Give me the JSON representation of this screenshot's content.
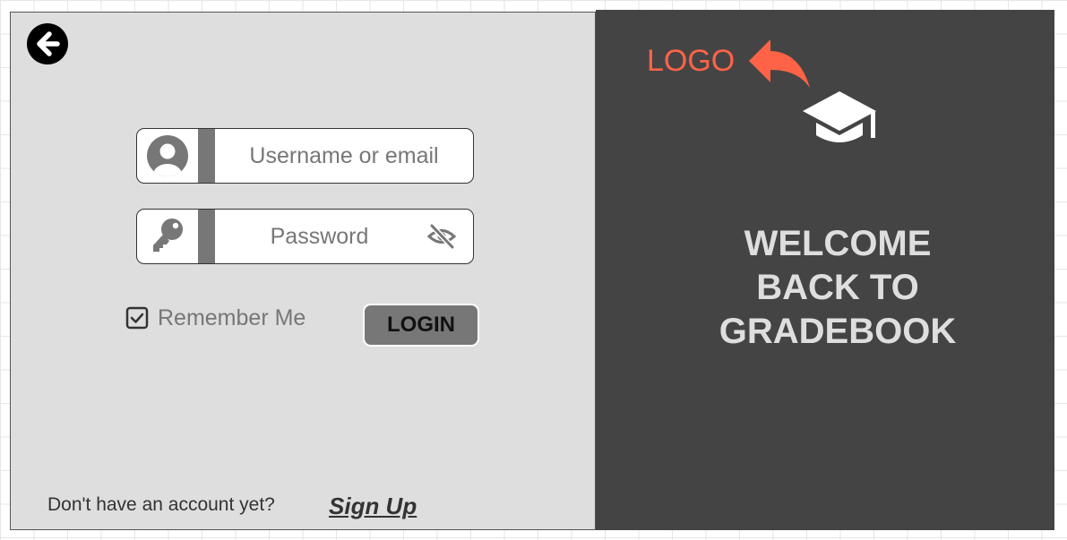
{
  "login_panel": {
    "username": {
      "placeholder": "Username or email",
      "icon": "user-circle-icon"
    },
    "password": {
      "placeholder": "Password",
      "icon": "key-icon",
      "toggle_icon": "eye-slash-icon"
    },
    "remember_me": {
      "label": "Remember Me",
      "checked": true
    },
    "login_label": "LOGIN",
    "back_icon": "arrow-left-circle-icon",
    "signup_prompt": "Don't have an account yet?",
    "signup_link": "Sign Up"
  },
  "brand_panel": {
    "logo_label": "LOGO",
    "logo_icon": "graduation-cap-icon",
    "annotation_arrow": "curved-arrow-icon",
    "welcome_lines": [
      "WELCOME",
      "BACK TO",
      "GRADEBOOK"
    ]
  },
  "colors": {
    "left_panel_bg": "#dedede",
    "right_panel_bg": "#444444",
    "accent": "#ff6347",
    "field_bar": "#777777",
    "placeholder_text": "#777777"
  }
}
